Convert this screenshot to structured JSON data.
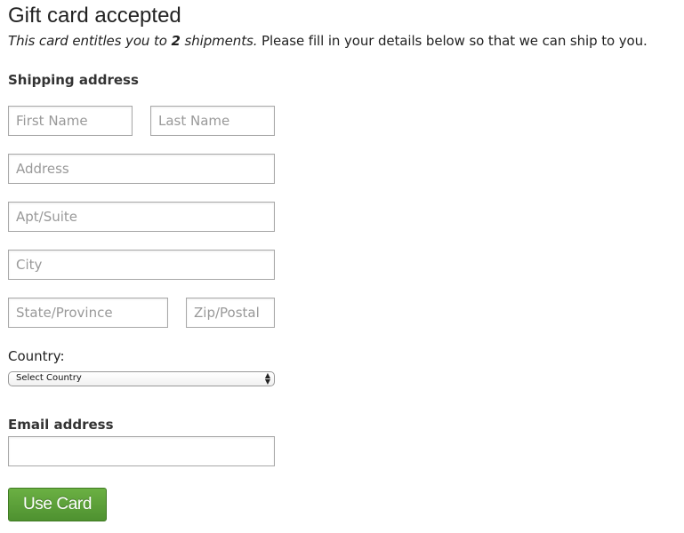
{
  "header": {
    "title": "Gift card accepted",
    "subtitle_italic_prefix": "This card entitles you to ",
    "subtitle_count": "2",
    "subtitle_italic_suffix": " shipments.",
    "subtitle_rest": " Please fill in your details below so that we can ship to you."
  },
  "shipping": {
    "section_label": "Shipping address",
    "first_name": {
      "placeholder": "First Name",
      "value": ""
    },
    "last_name": {
      "placeholder": "Last Name",
      "value": ""
    },
    "address": {
      "placeholder": "Address",
      "value": ""
    },
    "apt": {
      "placeholder": "Apt/Suite",
      "value": ""
    },
    "city": {
      "placeholder": "City",
      "value": ""
    },
    "state": {
      "placeholder": "State/Province",
      "value": ""
    },
    "zip": {
      "placeholder": "Zip/Postal",
      "value": ""
    },
    "country_label": "Country:",
    "country_selected": "Select Country",
    "country_arrows": "▴▾"
  },
  "email": {
    "section_label": "Email address",
    "value": ""
  },
  "submit": {
    "label": "Use Card",
    "color": "#5a9e36"
  }
}
